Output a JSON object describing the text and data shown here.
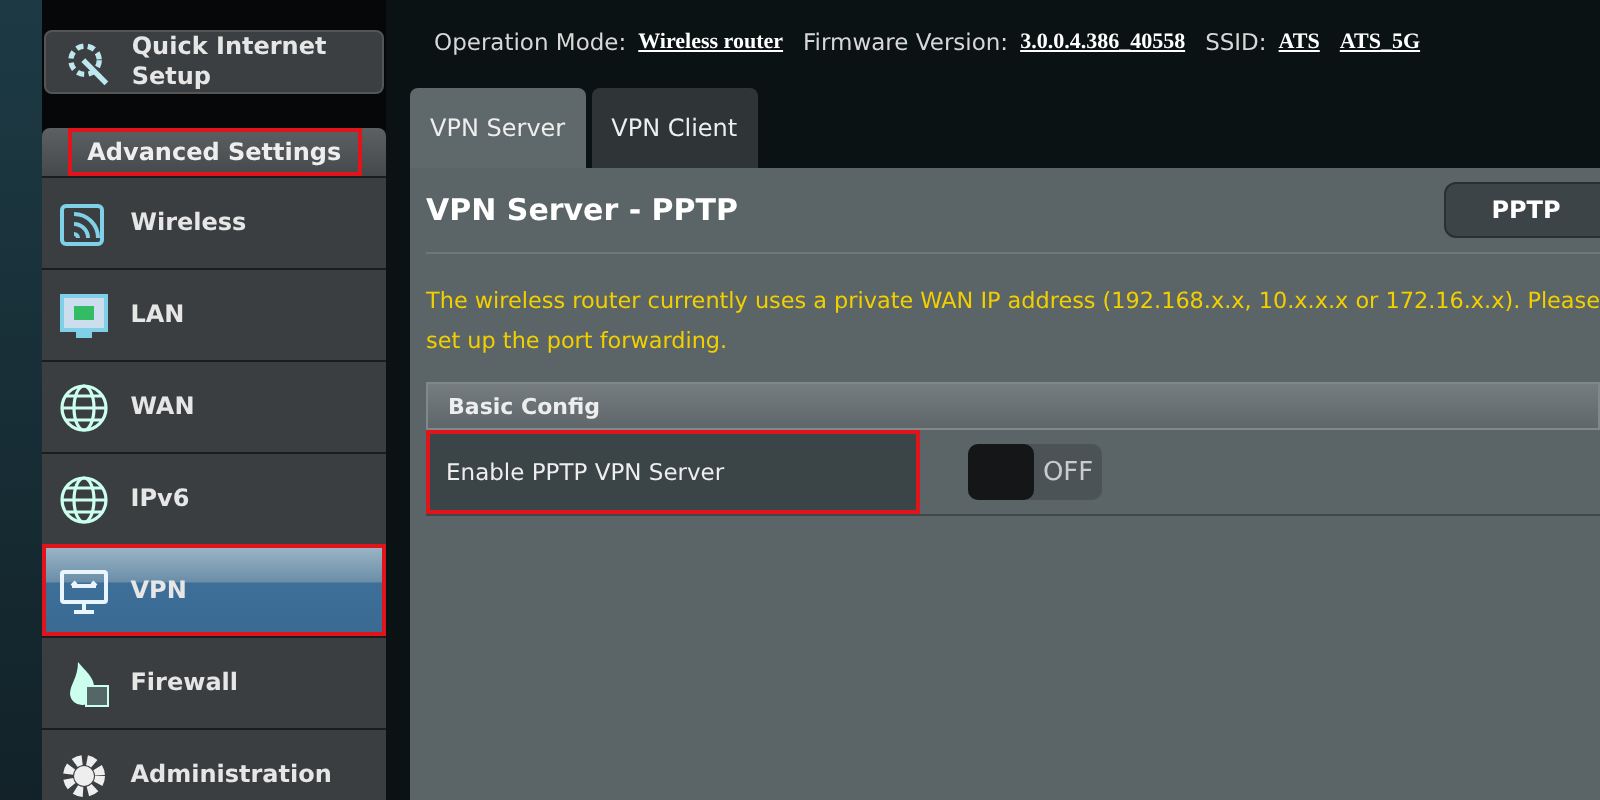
{
  "header": {
    "items": [
      {
        "label": "Operation Mode:",
        "value": "Wireless router"
      },
      {
        "label": "Firmware Version:",
        "value": "3.0.0.4.386_40558"
      },
      {
        "label": "SSID:",
        "value": "ATS"
      },
      {
        "value": "ATS_5G"
      }
    ]
  },
  "sidebar": {
    "quick_setup": {
      "label": "Quick Internet Setup"
    },
    "section": {
      "label": "Advanced Settings",
      "highlighted": true
    },
    "items": [
      {
        "label": "Wireless",
        "kind": "wifi",
        "selected": false,
        "highlighted": false
      },
      {
        "label": "LAN",
        "kind": "lan",
        "selected": false,
        "highlighted": false
      },
      {
        "label": "WAN",
        "kind": "globe",
        "selected": false,
        "highlighted": false
      },
      {
        "label": "IPv6",
        "kind": "ipv6",
        "selected": false,
        "highlighted": false
      },
      {
        "label": "VPN",
        "kind": "vpn",
        "selected": true,
        "highlighted": true
      },
      {
        "label": "Firewall",
        "kind": "fire",
        "selected": false,
        "highlighted": false
      },
      {
        "label": "Administration",
        "kind": "gear",
        "selected": false,
        "highlighted": false
      }
    ]
  },
  "tabs": [
    {
      "label": "VPN Server",
      "selected": true
    },
    {
      "label": "VPN Client",
      "selected": false
    }
  ],
  "panel": {
    "title": "VPN Server - PPTP",
    "mode_button": "PPTP",
    "warning": "The wireless router currently uses a private WAN IP address (192.168.x.x, 10.x.x.x or 172.16.x.x). Please",
    "warning_line2": "set up the port forwarding.",
    "section": "Basic Config",
    "rows": [
      {
        "label": "Enable PPTP VPN Server",
        "highlighted": true,
        "toggle": {
          "on": false,
          "text": "OFF"
        }
      }
    ]
  }
}
